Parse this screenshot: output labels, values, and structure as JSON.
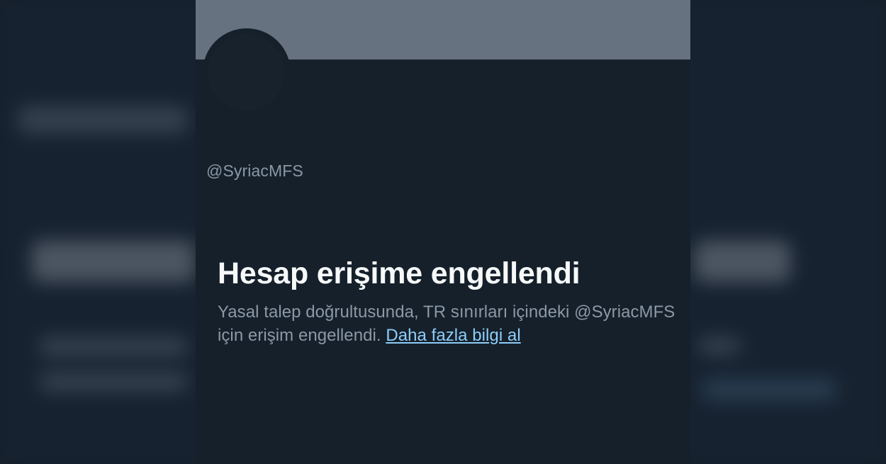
{
  "profile": {
    "handle": "@SyriacMFS"
  },
  "withheld_notice": {
    "title": "Hesap erişime engellendi",
    "body_prefix": "Yasal talep doğrultusunda, TR sınırları içindeki @SyriacMFS için erişim engellendi.",
    "link_label": "Daha fazla bilgi al"
  },
  "colors": {
    "background": "#15202b",
    "banner": "#66727f",
    "primary_text": "#f7f9f9",
    "secondary_text": "#8b98a5",
    "link": "#8ecdf8"
  }
}
